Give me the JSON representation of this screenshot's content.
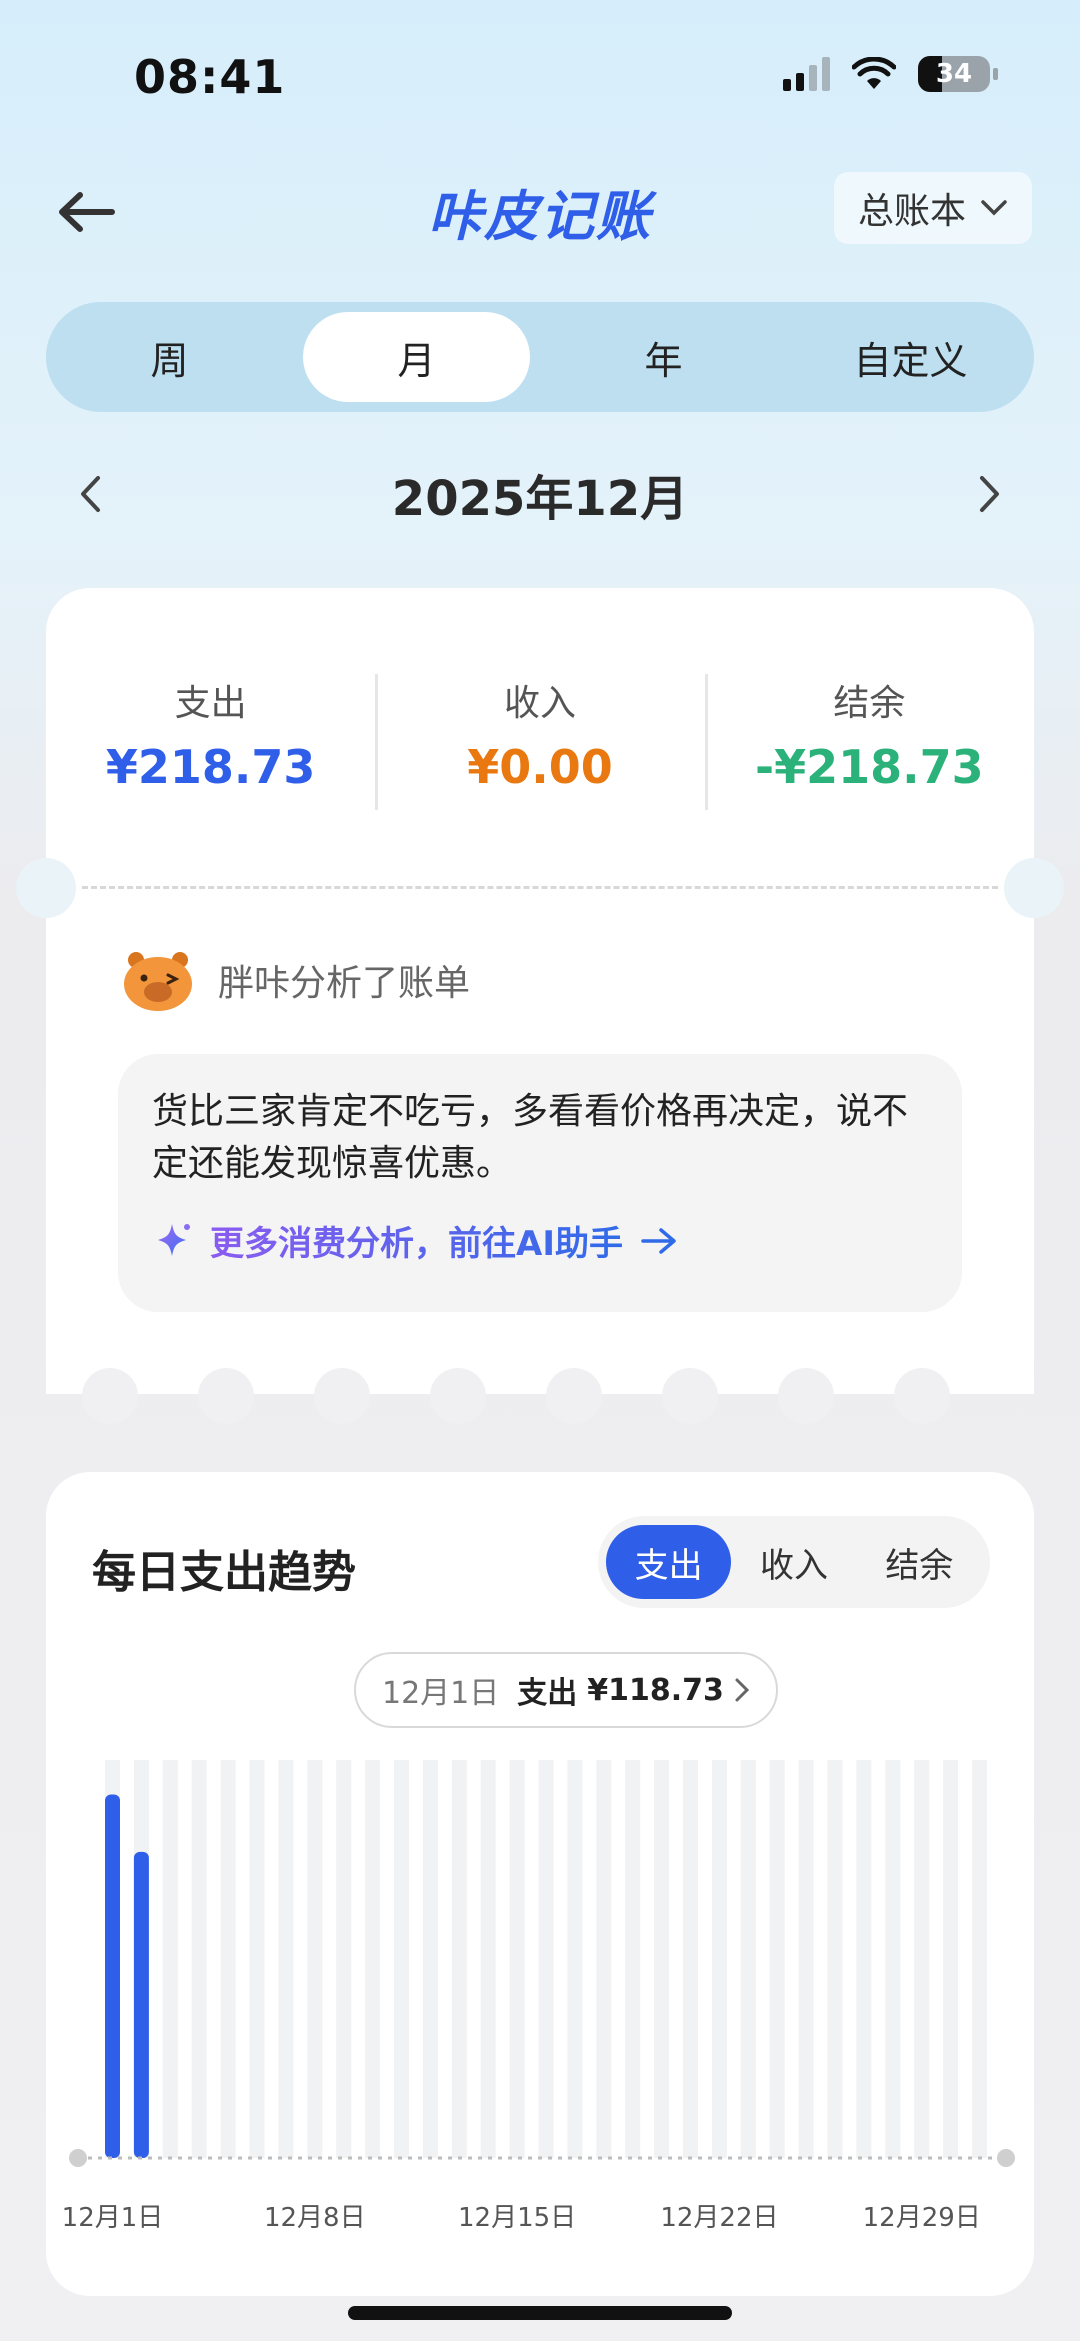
{
  "status_bar": {
    "time": "08:41",
    "battery": "34"
  },
  "header": {
    "app_title": "咔皮记账",
    "ledger_label": "总账本"
  },
  "period_tabs": [
    {
      "label": "周",
      "active": false
    },
    {
      "label": "月",
      "active": true
    },
    {
      "label": "年",
      "active": false
    },
    {
      "label": "自定义",
      "active": false
    }
  ],
  "month_nav": {
    "label": "2025年12月"
  },
  "summary": {
    "expense_label": "支出",
    "expense_value": "¥218.73",
    "income_label": "收入",
    "income_value": "¥0.00",
    "balance_label": "结余",
    "balance_value": "-¥218.73"
  },
  "analysis": {
    "title": "胖咔分析了账单",
    "text": "货比三家肯定不吃亏，多看看价格再决定，说不定还能发现惊喜优惠。",
    "link": "更多消费分析，前往AI助手"
  },
  "trend": {
    "title": "每日支出趋势",
    "toggles": [
      {
        "label": "支出",
        "active": true
      },
      {
        "label": "收入",
        "active": false
      },
      {
        "label": "结余",
        "active": false
      }
    ],
    "tooltip": {
      "date": "12月1日",
      "type": "支出",
      "amount": "¥118.73"
    }
  },
  "colors": {
    "accent": "#2f5ee8",
    "income": "#e8780f",
    "balance": "#2bb27a"
  },
  "chart_data": {
    "type": "bar",
    "categories": [
      "12月1日",
      "12月2日",
      "12月3日",
      "12月4日",
      "12月5日",
      "12月6日",
      "12月7日",
      "12月8日",
      "12月9日",
      "12月10日",
      "12月11日",
      "12月12日",
      "12月13日",
      "12月14日",
      "12月15日",
      "12月16日",
      "12月17日",
      "12月18日",
      "12月19日",
      "12月20日",
      "12月21日",
      "12月22日",
      "12月23日",
      "12月24日",
      "12月25日",
      "12月26日",
      "12月27日",
      "12月28日",
      "12月29日",
      "12月30日",
      "12月31日"
    ],
    "values": [
      118.73,
      100.0,
      0,
      0,
      0,
      0,
      0,
      0,
      0,
      0,
      0,
      0,
      0,
      0,
      0,
      0,
      0,
      0,
      0,
      0,
      0,
      0,
      0,
      0,
      0,
      0,
      0,
      0,
      0,
      0,
      0
    ],
    "tick_labels": [
      "12月1日",
      "12月8日",
      "12月15日",
      "12月22日",
      "12月29日"
    ],
    "ylim": [
      0,
      130
    ],
    "grid": false
  }
}
